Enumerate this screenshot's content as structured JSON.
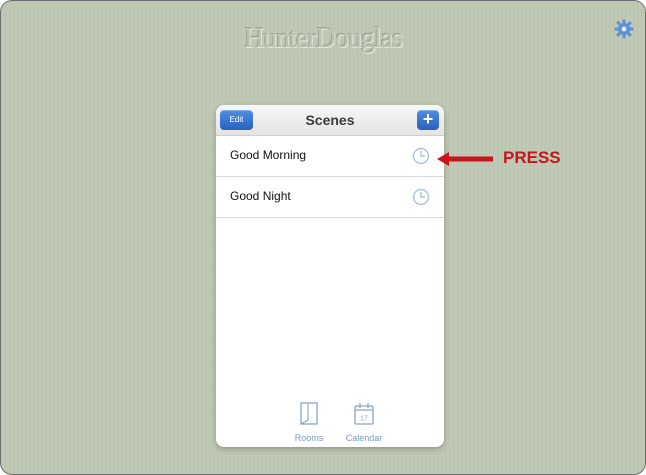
{
  "app": {
    "logo_text": "HunterDouglas",
    "settings_icon": "gear-icon"
  },
  "scenes_panel": {
    "edit_label": "Edit",
    "title": "Scenes",
    "add_label": "+",
    "items": [
      {
        "label": "Good Morning",
        "icon": "clock-icon"
      },
      {
        "label": "Good Night",
        "icon": "clock-icon"
      }
    ]
  },
  "tabbar": {
    "tabs": [
      {
        "label": "Rooms",
        "icon": "rooms-icon"
      },
      {
        "label": "Calendar",
        "icon": "calendar-icon",
        "icon_text": "17"
      }
    ]
  },
  "annotation": {
    "text": "PRESS",
    "color": "#c4161c"
  },
  "colors": {
    "background": "#bfc8b3",
    "accent": "#2f6fd0",
    "tab_text": "#7a9bc2"
  }
}
